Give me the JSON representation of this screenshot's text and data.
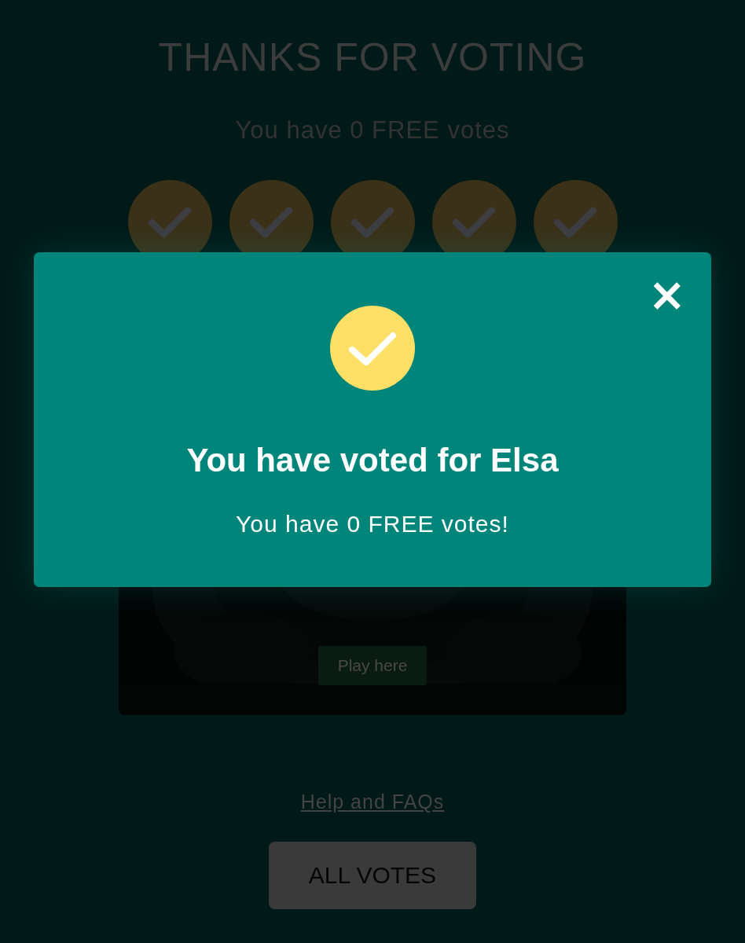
{
  "page": {
    "title": "THANKS FOR VOTING",
    "subtitle": "You have 0 FREE votes"
  },
  "votes": [
    {
      "used": true
    },
    {
      "used": true
    },
    {
      "used": true
    },
    {
      "used": true
    },
    {
      "used": true
    }
  ],
  "video": {
    "kind": "picture",
    "button": "Play here"
  },
  "help_link": "Help and FAQs",
  "all_votes_button": "ALL VOTES",
  "dialog": {
    "title": "You have voted for Elsa",
    "message": "You have 0 FREE votes!",
    "close": "×"
  }
}
